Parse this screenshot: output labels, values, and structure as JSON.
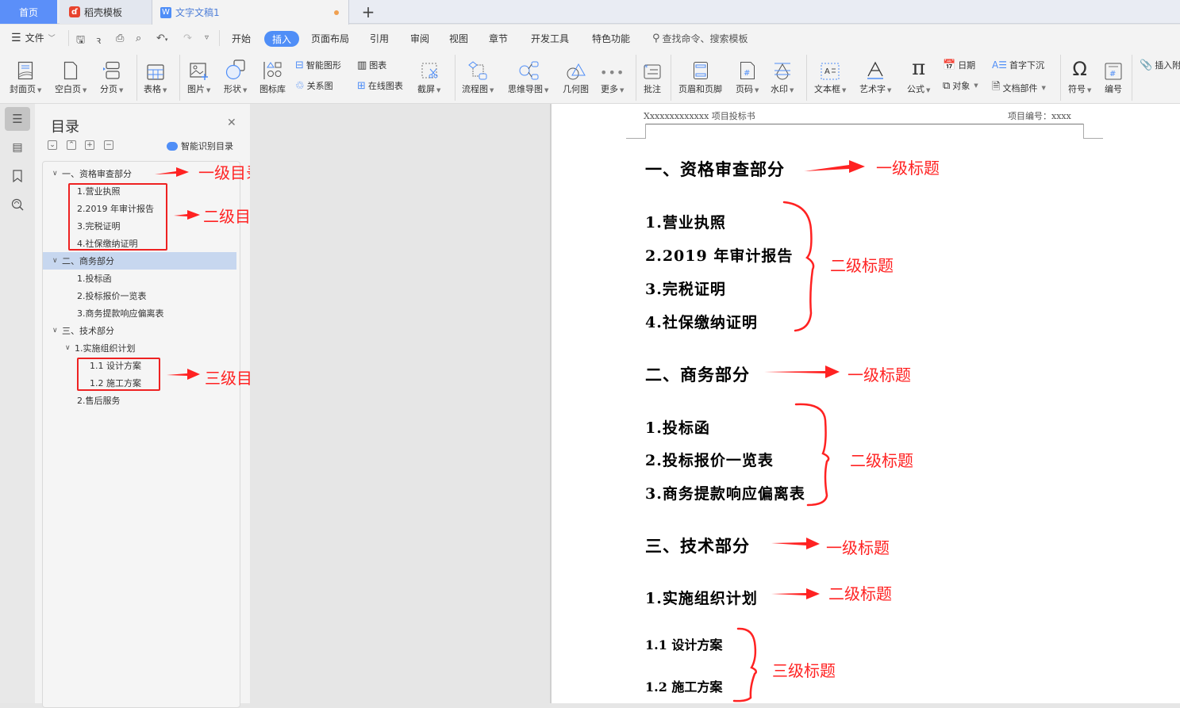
{
  "tabs": {
    "home": "首页",
    "daoke": "稻壳模板",
    "document": "文字文稿1",
    "add": "+"
  },
  "menubar": {
    "file": "文件",
    "items": [
      "开始",
      "插入",
      "页面布局",
      "引用",
      "审阅",
      "视图",
      "章节",
      "开发工具",
      "特色功能"
    ],
    "active": "插入",
    "search": "查找命令、搜索模板"
  },
  "ribbon": {
    "cover": "封面页",
    "blank": "空白页",
    "page_break": "分页",
    "table": "表格",
    "picture": "图片",
    "shape": "形状",
    "icon_lib": "图标库",
    "smart_art": "智能图形",
    "relation": "关系图",
    "chart": "图表",
    "online_chart": "在线图表",
    "screenshot": "截屏",
    "flowchart": "流程图",
    "mindmap": "思维导图",
    "geometry": "几何图",
    "more": "更多",
    "comment": "批注",
    "header_footer": "页眉和页脚",
    "page_number": "页码",
    "watermark": "水印",
    "textbox": "文本框",
    "wordart": "艺术字",
    "formula": "公式",
    "date": "日期",
    "object": "对象",
    "drop_cap": "首字下沉",
    "doc_parts": "文档部件",
    "symbol": "符号",
    "numbering": "编号",
    "attachment": "插入附"
  },
  "toc": {
    "title": "目录",
    "smart_detect": "智能识别目录",
    "items": [
      {
        "label": "一、资格审查部分",
        "level": 1,
        "expanded": true
      },
      {
        "label": "1.营业执照",
        "level": 2
      },
      {
        "label": "2.2019 年审计报告",
        "level": 2
      },
      {
        "label": "3.完税证明",
        "level": 2
      },
      {
        "label": "4.社保缴纳证明",
        "level": 2
      },
      {
        "label": "二、商务部分",
        "level": 1,
        "expanded": true,
        "selected": true
      },
      {
        "label": "1.投标函",
        "level": 2
      },
      {
        "label": "2.投标报价一览表",
        "level": 2
      },
      {
        "label": "3.商务提款响应偏离表",
        "level": 2
      },
      {
        "label": "三、技术部分",
        "level": 1,
        "expanded": true
      },
      {
        "label": "1.实施组织计划",
        "level": 2,
        "expanded": true
      },
      {
        "label": "1.1 设计方案",
        "level": 3
      },
      {
        "label": "1.2 施工方案",
        "level": 3
      },
      {
        "label": "2.售后服务",
        "level": 2
      }
    ],
    "annotations": {
      "level1": "一级目录",
      "level2": "二级目录",
      "level3": "三级目录"
    }
  },
  "document": {
    "header_left": "Xxxxxxxxxxxxx 项目投标书",
    "header_right": "项目编号：xxxx",
    "headings": [
      {
        "text": "一、资格审查部分",
        "level": 1
      },
      {
        "text": "1.营业执照",
        "level": 2
      },
      {
        "text": "2.2019 年审计报告",
        "level": 2
      },
      {
        "text": "3.完税证明",
        "level": 2
      },
      {
        "text": "4.社保缴纳证明",
        "level": 2
      },
      {
        "text": "二、商务部分",
        "level": 1
      },
      {
        "text": "1.投标函",
        "level": 2
      },
      {
        "text": "2.投标报价一览表",
        "level": 2
      },
      {
        "text": "3.商务提款响应偏离表",
        "level": 2
      },
      {
        "text": "三、技术部分",
        "level": 1
      },
      {
        "text": "1.实施组织计划",
        "level": 2
      },
      {
        "text": "1.1 设计方案",
        "level": 3
      },
      {
        "text": "1.2 施工方案",
        "level": 3
      }
    ],
    "annotations": {
      "level1": "一级标题",
      "level2": "二级标题",
      "level3": "三级标题"
    }
  },
  "colors": {
    "accent": "#4f8ef7",
    "home_tab": "#5b8ff9",
    "annotation": "#ff2222",
    "toc_selected": "#c7d7ef"
  }
}
